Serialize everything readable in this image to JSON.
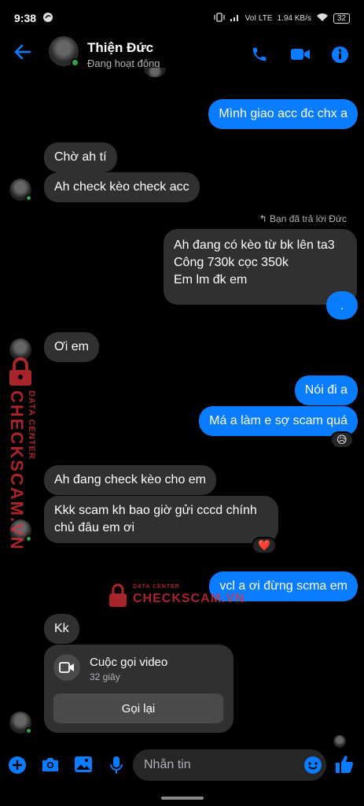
{
  "status_bar": {
    "time": "9:38",
    "network": "VoI LTE",
    "speed": "1.94 KB/s",
    "battery": "32"
  },
  "header": {
    "contact_name": "Thiện Đức",
    "contact_status": "Đang hoạt động",
    "back_icon": "back-arrow-icon",
    "call_icon": "phone-icon",
    "video_icon": "video-camera-icon",
    "info_icon": "info-icon"
  },
  "messages": {
    "m1": "Mình giao acc đc chx a",
    "m2": "Chờ ah tí",
    "m3": "Ah check kèo check acc",
    "reply_note": "Bạn đã trả lời Đức",
    "m4": "Ah đang có kèo từ bk lên ta3\nCông 730k cọc 350k\nEm lm đk em",
    "m5": ".",
    "m6": "Ơi em",
    "m7": "Nói đi a",
    "m8": "Má a làm e sợ scam quá",
    "m8_reaction": "😥",
    "m9": "Ah đang check kèo cho em",
    "m10": "Kkk scam kh bao giờ gửi cccd chính\nchủ đâu em ơi",
    "m10_reaction": "❤️",
    "m11": "vcl a ơi đừng scma em",
    "m12": "Kk"
  },
  "call_card": {
    "title": "Cuộc gọi video",
    "duration": "32 giây",
    "recall_label": "Gọi lại"
  },
  "composer": {
    "placeholder": "Nhắn tin"
  },
  "watermark": {
    "vertical_top": "DATA CENTER",
    "vertical_main": "CHECKSCAM.VN",
    "center_top": "DATA CENTER",
    "center_main": "CHECKSCAM.VN"
  },
  "colors": {
    "accent": "#0a7cff",
    "incoming_bubble": "#303030",
    "online": "#31a24c",
    "watermark": "#e0303a"
  }
}
